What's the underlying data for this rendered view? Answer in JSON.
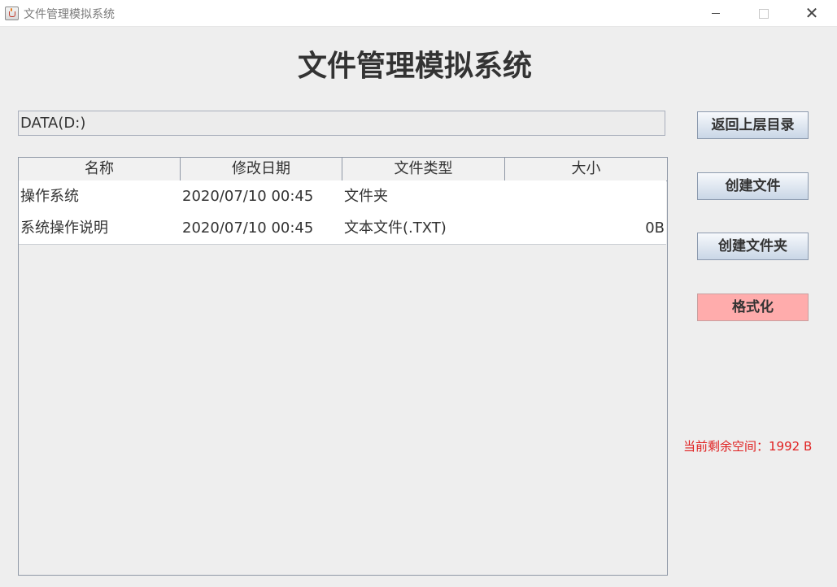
{
  "window": {
    "title": "文件管理模拟系统",
    "close_glyph": "✕"
  },
  "heading": "文件管理模拟系统",
  "path": "DATA(D:)",
  "table": {
    "columns": [
      "名称",
      "修改日期",
      "文件类型",
      "大小"
    ],
    "rows": [
      {
        "name": "操作系统",
        "date": "2020/07/10 00:45",
        "type": "文件夹",
        "size": ""
      },
      {
        "name": "系统操作说明",
        "date": "2020/07/10 00:45",
        "type": "文本文件(.TXT)",
        "size": "0B"
      }
    ]
  },
  "buttons": {
    "back": "返回上层目录",
    "create_file": "创建文件",
    "create_folder": "创建文件夹",
    "format": "格式化"
  },
  "free_space": "当前剩余空间：1992 B",
  "colors": {
    "format_button": "#ffacac",
    "free_space_text": "#e02020"
  }
}
